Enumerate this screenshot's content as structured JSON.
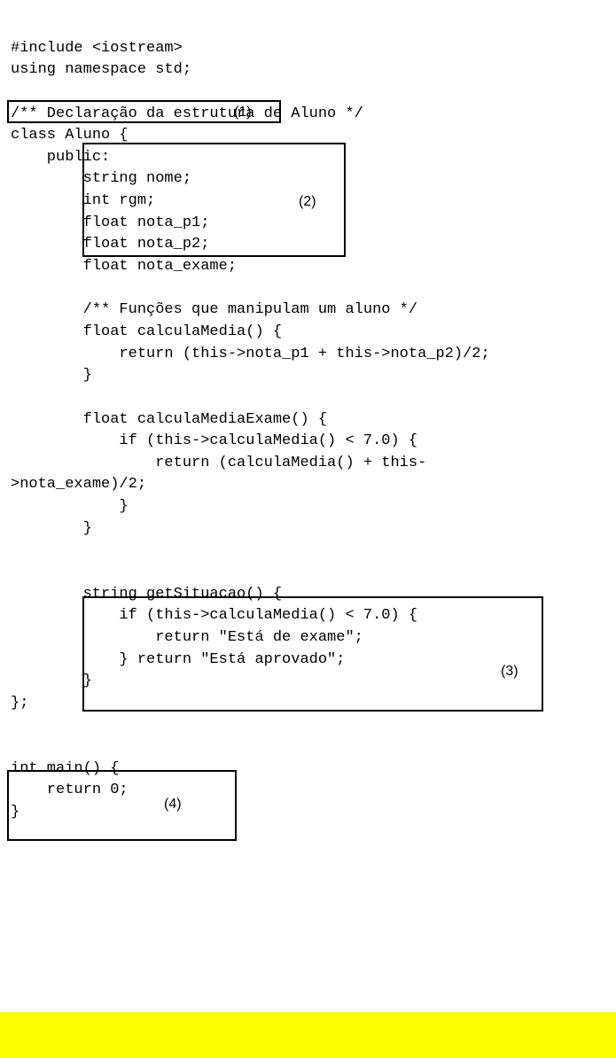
{
  "code": {
    "line1": "#include <iostream>",
    "line2": "using namespace std;",
    "line3": "",
    "line4": "/** Declaração da estrutura de Aluno */",
    "line5": "class Aluno {",
    "line6": "    public:",
    "line7": "        string nome;",
    "line8": "        int rgm;",
    "line9": "        float nota_p1;",
    "line10": "        float nota_p2;",
    "line11": "        float nota_exame;",
    "line12": "",
    "line13": "        /** Funções que manipulam um aluno */",
    "line14": "        float calculaMedia() {",
    "line15": "            return (this->nota_p1 + this->nota_p2)/2;",
    "line16": "        }",
    "line17": "",
    "line18": "        float calculaMediaExame() {",
    "line19": "            if (this->calculaMedia() < 7.0) {",
    "line20": "                return (calculaMedia() + this-",
    "line21": ">nota_exame)/2;",
    "line22": "            }",
    "line23": "        }",
    "line24": "",
    "line25": "",
    "line26": "        string getSituacao() {",
    "line27": "            if (this->calculaMedia() < 7.0) {",
    "line28": "                return \"Está de exame\";",
    "line29": "            } return \"Está aprovado\";",
    "line30": "        }",
    "line31": "};",
    "line32": "",
    "line33": "",
    "line34": "int main() {",
    "line35": "    return 0;",
    "line36": "}"
  },
  "annotations": {
    "label1": "(1)",
    "label2": "(2)",
    "label3": "(3)",
    "label4": "(4)"
  }
}
